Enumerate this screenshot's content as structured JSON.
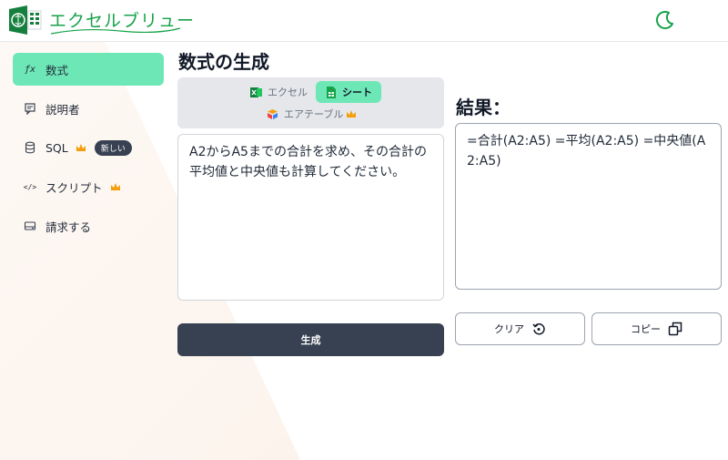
{
  "header": {
    "brand": "エクセルブリュー",
    "logo_icon": "excel-brain-logo-icon",
    "theme_toggle_icon": "moon-icon",
    "brand_color": "#16a34a"
  },
  "sidebar": {
    "items": [
      {
        "label": "数式",
        "icon": "fx",
        "active": true
      },
      {
        "label": "説明者",
        "icon": "message-icon"
      },
      {
        "label": "SQL",
        "icon": "database-icon",
        "badge": "新しい",
        "premium": true
      },
      {
        "label": "スクリプト",
        "icon": "code-icon",
        "premium": true
      },
      {
        "label": "請求する",
        "icon": "billing-icon"
      }
    ],
    "fx_glyph": "ƒx",
    "code_glyph": "</>"
  },
  "main": {
    "title": "数式の生成",
    "tabs": [
      {
        "label": "エクセル",
        "selected": false
      },
      {
        "label": "シート",
        "selected": true
      },
      {
        "label": "エアテーブル",
        "selected": false,
        "premium": true
      }
    ],
    "input_value": "A2からA5までの合計を求め、その合計の平均値と中央値も計算してください。",
    "generate_label": "生成"
  },
  "result": {
    "title": "結果：",
    "value": "=合計(A2:A5) =平均(A2:A5) =中央値(A2:A5)",
    "clear_label": "クリア",
    "copy_label": "コピー"
  },
  "colors": {
    "accent": "#6ee7b7",
    "dark_button": "#374151",
    "premium": "#f59e0b"
  }
}
